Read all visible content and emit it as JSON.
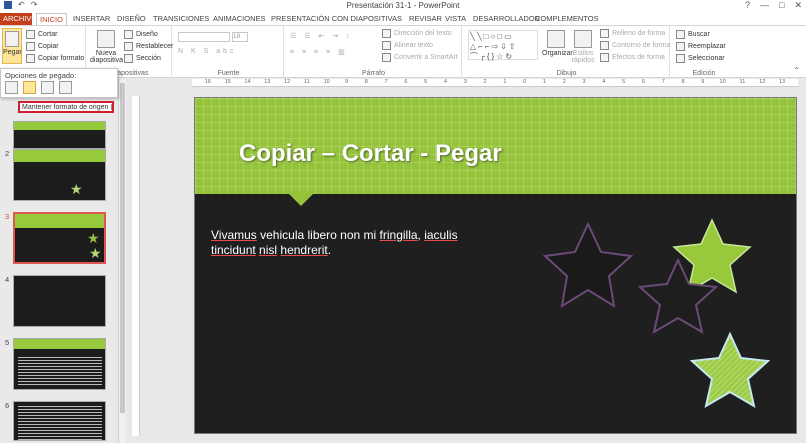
{
  "window": {
    "title": "Presentación 31-1 - PowerPoint",
    "controls": [
      "?",
      "—",
      "□",
      "✕"
    ]
  },
  "tabs": [
    {
      "label": "ARCHIVO"
    },
    {
      "label": "INICIO"
    },
    {
      "label": "INSERTAR"
    },
    {
      "label": "DISEÑO"
    },
    {
      "label": "TRANSICIONES"
    },
    {
      "label": "ANIMACIONES"
    },
    {
      "label": "PRESENTACIÓN CON DIAPOSITIVAS"
    },
    {
      "label": "REVISAR"
    },
    {
      "label": "VISTA"
    },
    {
      "label": "DESARROLLADOR"
    },
    {
      "label": "COMPLEMENTOS"
    }
  ],
  "ribbon": {
    "clipboard": {
      "paste": "Pegar",
      "cut": "Cortar",
      "copy": "Copiar",
      "format_painter": "Copiar formato"
    },
    "slides": {
      "label": "Diapositivas",
      "new_slide": "Nueva diapositiva",
      "layout": "Diseño",
      "reset": "Restablecer",
      "section": "Sección"
    },
    "font": {
      "label": "Fuente",
      "size": "18"
    },
    "paragraph": {
      "label": "Párrafo",
      "text_direction": "Dirección del texto",
      "align_text": "Alinear texto",
      "smartart": "Convertir a SmartArt"
    },
    "drawing": {
      "label": "Dibujo",
      "arrange": "Organizar",
      "quick_styles": "Estilos rápidos",
      "shape_fill": "Relleno de forma",
      "shape_outline": "Contorno de forma",
      "shape_effects": "Efectos de forma"
    },
    "editing": {
      "label": "Edición",
      "find": "Buscar",
      "replace": "Reemplazar",
      "select": "Seleccionar"
    }
  },
  "paste_menu": {
    "title": "Opciones de pegado:",
    "tooltip": "Mantener formato de origen (M)"
  },
  "ruler": {
    "marks": [
      "16",
      "15",
      "14",
      "13",
      "12",
      "11",
      "10",
      "9",
      "8",
      "7",
      "6",
      "5",
      "4",
      "3",
      "2",
      "1",
      "0",
      "1",
      "2",
      "3",
      "4",
      "5",
      "6",
      "7",
      "8",
      "9",
      "10",
      "11",
      "12",
      "13",
      "14",
      "15",
      "16"
    ]
  },
  "slides": [
    {
      "number": "1"
    },
    {
      "number": "2"
    },
    {
      "number": "3"
    },
    {
      "number": "4"
    },
    {
      "number": "5"
    },
    {
      "number": "6"
    }
  ],
  "current_slide": {
    "title": "Copiar – Cortar - Pegar",
    "body_parts": [
      "Vivamus",
      " vehicula libero non mi ",
      "fringilla",
      ", ",
      "iaculis",
      " ",
      "tincidunt",
      " ",
      "nisl",
      " ",
      "hendrerit",
      "."
    ]
  },
  "colors": {
    "accent_green": "#95c43b",
    "file_tab": "#c43e1c",
    "slide_bg": "#1f1f1f",
    "tooltip_border": "#d01f2f"
  }
}
